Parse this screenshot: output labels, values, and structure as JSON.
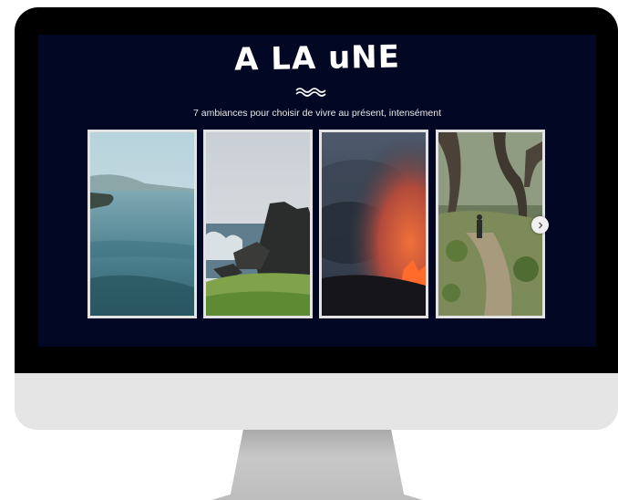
{
  "section": {
    "title": "A LA uNE",
    "subtitle": "7 ambiances pour choisir de vivre au présent, intensément"
  },
  "carousel": {
    "cards": [
      {
        "scene": "coastal-lagoon"
      },
      {
        "scene": "volcanic-rocky-coast"
      },
      {
        "scene": "lava-eruption-smoke"
      },
      {
        "scene": "forest-hiker"
      }
    ],
    "next_icon": "chevron-right-icon"
  },
  "colors": {
    "screen_bg": "#020823",
    "bezel": "#000000",
    "chin": "#e5e5e5",
    "card_border": "#e3e3e3",
    "text": "#ffffff"
  }
}
